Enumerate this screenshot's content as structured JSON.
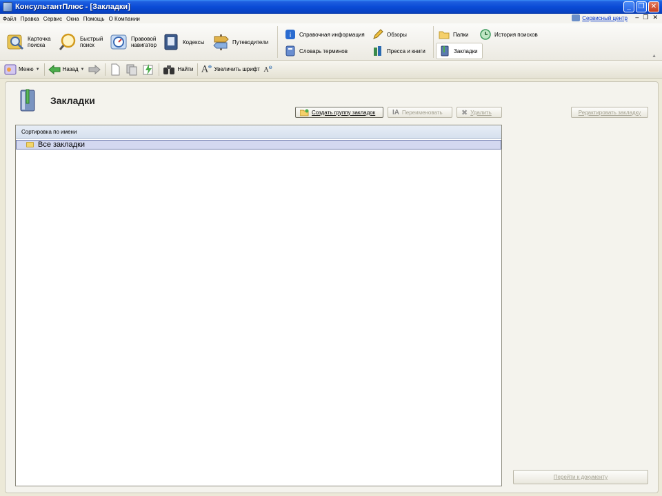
{
  "window": {
    "title": "КонсультантПлюс - [Закладки]"
  },
  "menu": {
    "items": [
      "Файл",
      "Правка",
      "Сервис",
      "Окна",
      "Помощь",
      "О Компании"
    ],
    "service_center": "Сервисный центр"
  },
  "ribbon": {
    "search_card": [
      "Карточка",
      "поиска"
    ],
    "quick_search": [
      "Быстрый",
      "поиск"
    ],
    "legal_navigator": [
      "Правовой",
      "навигатор"
    ],
    "codes": "Кодексы",
    "guides": "Путеводители",
    "reference_info": "Справочная информация",
    "reviews": "Обзоры",
    "glossary": "Словарь терминов",
    "press_books": "Пресса и книги",
    "folders": "Папки",
    "search_history": "История поисков",
    "bookmarks": "Закладки"
  },
  "toolbar": {
    "menu": "Меню",
    "back": "Назад",
    "find": "Найти",
    "enlarge_font": "Увеличить шрифт"
  },
  "page": {
    "title": "Закладки",
    "create_group": "Создать группу закладок",
    "rename": "Переименовать",
    "delete": "Удалить",
    "edit_bookmark": "Редактировать закладку",
    "sort_header": "Сортировка по имени",
    "tree_items": [
      "Все закладки"
    ],
    "go_to_document": "Перейти к документу"
  }
}
